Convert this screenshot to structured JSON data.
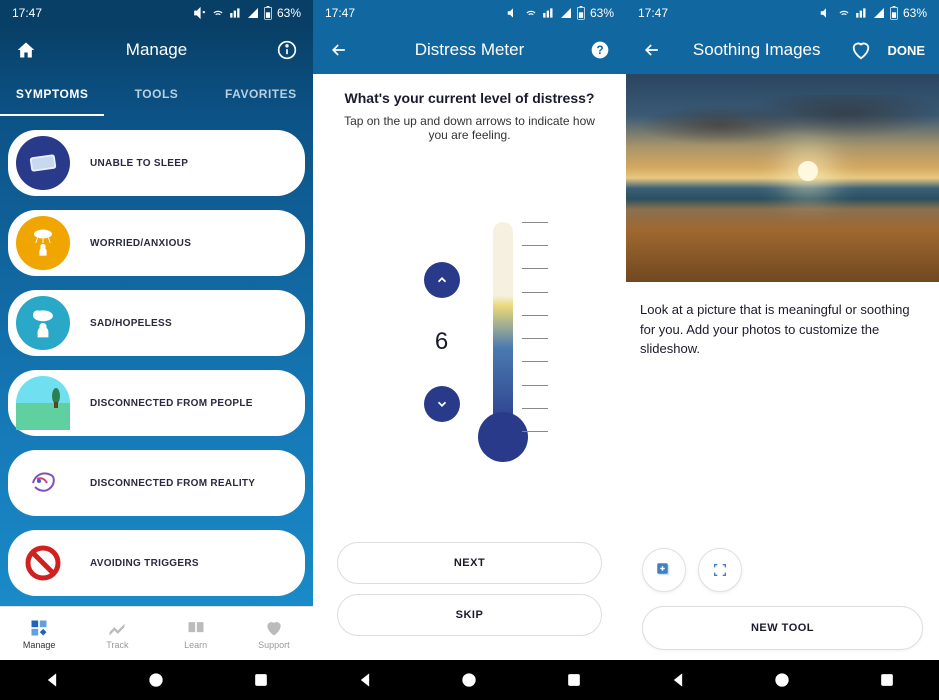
{
  "statusbar": {
    "time": "17:47",
    "battery": "63%"
  },
  "phone1": {
    "title": "Manage",
    "tabs": [
      "SYMPTOMS",
      "TOOLS",
      "FAVORITES"
    ],
    "activeTab": 0,
    "symptoms": [
      {
        "label": "UNABLE TO SLEEP",
        "iconBg": "#2a3a8a"
      },
      {
        "label": "WORRIED/ANXIOUS",
        "iconBg": "#f0a500"
      },
      {
        "label": "SAD/HOPELESS",
        "iconBg": "#2aa8c8"
      },
      {
        "label": "DISCONNECTED FROM PEOPLE",
        "iconBg": "#60d0a0"
      },
      {
        "label": "DISCONNECTED FROM REALITY",
        "iconBg": "#ffffff"
      },
      {
        "label": "AVOIDING TRIGGERS",
        "iconBg": "#ffffff"
      }
    ],
    "bottomnav": [
      {
        "label": "Manage",
        "active": true
      },
      {
        "label": "Track",
        "active": false
      },
      {
        "label": "Learn",
        "active": false
      },
      {
        "label": "Support",
        "active": false
      }
    ]
  },
  "phone2": {
    "title": "Distress Meter",
    "heading": "What's your current level of distress?",
    "subtext": "Tap on the up and down arrows to indicate how you are feeling.",
    "value": "6",
    "buttons": {
      "next": "NEXT",
      "skip": "SKIP"
    }
  },
  "phone3": {
    "title": "Soothing Images",
    "done": "DONE",
    "description": "Look at a picture that is meaningful or soothing for you. Add your photos to customize the slideshow.",
    "newTool": "NEW TOOL"
  }
}
